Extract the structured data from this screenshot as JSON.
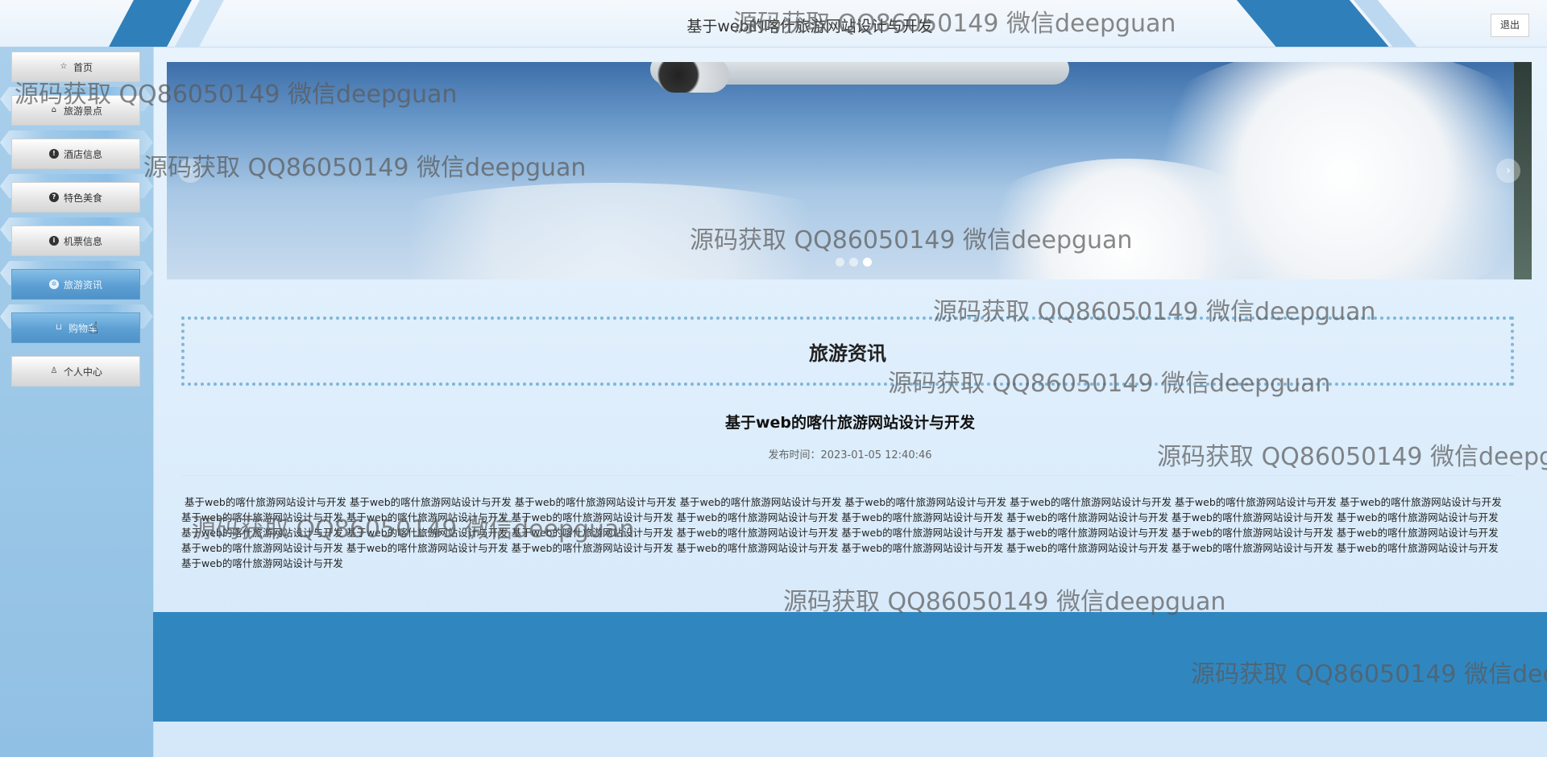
{
  "header": {
    "title": "基于web的喀什旅游网站设计与开发",
    "logout_label": "退出"
  },
  "sidebar": {
    "items": [
      {
        "label": "首页",
        "icon": "star-icon"
      },
      {
        "label": "旅游景点",
        "icon": "bag-icon"
      },
      {
        "label": "酒店信息",
        "icon": "exclamation-circle-icon"
      },
      {
        "label": "特色美食",
        "icon": "question-circle-icon"
      },
      {
        "label": "机票信息",
        "icon": "info-circle-icon"
      },
      {
        "label": "旅游资讯",
        "icon": "gear-circle-icon"
      },
      {
        "label": "购物车",
        "icon": "cart-icon"
      },
      {
        "label": "个人中心",
        "icon": "user-icon"
      }
    ]
  },
  "banner": {
    "prev_arrow": "‹",
    "next_arrow": "›",
    "dot_count": 3,
    "active_dot": 3
  },
  "section": {
    "title": "旅游资讯"
  },
  "article": {
    "title": "基于web的喀什旅游网站设计与开发",
    "publish_time": "发布时间：2023-01-05 12:40:46",
    "body": "基于web的喀什旅游网站设计与开发 基于web的喀什旅游网站设计与开发 基于web的喀什旅游网站设计与开发 基于web的喀什旅游网站设计与开发 基于web的喀什旅游网站设计与开发 基于web的喀什旅游网站设计与开发 基于web的喀什旅游网站设计与开发 基于web的喀什旅游网站设计与开发 基于web的喀什旅游网站设计与开发 基于web的喀什旅游网站设计与开发 基于web的喀什旅游网站设计与开发 基于web的喀什旅游网站设计与开发 基于web的喀什旅游网站设计与开发 基于web的喀什旅游网站设计与开发 基于web的喀什旅游网站设计与开发 基于web的喀什旅游网站设计与开发 基于web的喀什旅游网站设计与开发 基于web的喀什旅游网站设计与开发 基于web的喀什旅游网站设计与开发 基于web的喀什旅游网站设计与开发 基于web的喀什旅游网站设计与开发 基于web的喀什旅游网站设计与开发 基于web的喀什旅游网站设计与开发 基于web的喀什旅游网站设计与开发 基于web的喀什旅游网站设计与开发 基于web的喀什旅游网站设计与开发 基于web的喀什旅游网站设计与开发 基于web的喀什旅游网站设计与开发 基于web的喀什旅游网站设计与开发 基于web的喀什旅游网站设计与开发 基于web的喀什旅游网站设计与开发 基于web的喀什旅游网站设计与开发 基于web的喀什旅游网站设计与开发"
  },
  "watermark": {
    "text": "源码获取 QQ86050149 微信deepguan"
  }
}
